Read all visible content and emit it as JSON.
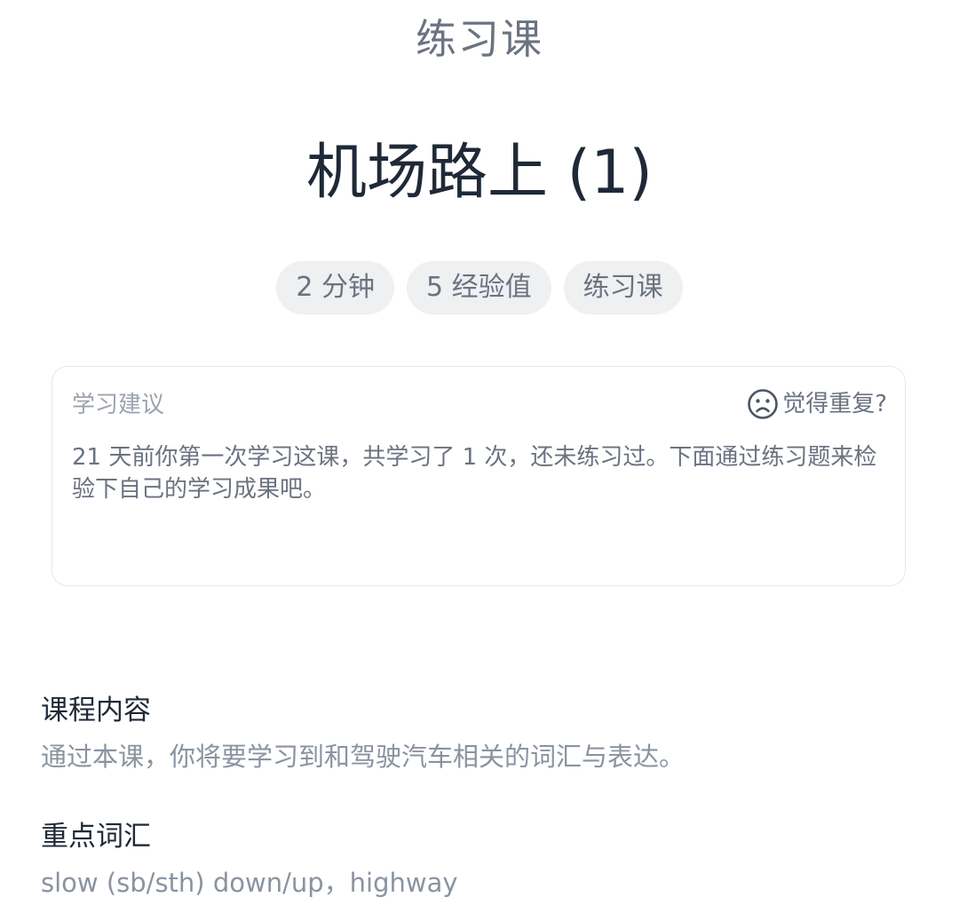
{
  "header": {
    "title": "练习课"
  },
  "lesson": {
    "title": "机场路上 (1)"
  },
  "tags": [
    "2 分钟",
    "5 经验值",
    "练习课"
  ],
  "advice": {
    "label": "学习建议",
    "repeat_label": "觉得重复?",
    "repeat_icon": "sad-face-icon",
    "text": "21 天前你第一次学习这课，共学习了 1 次，还未练习过。下面通过练习题来检验下自己的学习成果吧。"
  },
  "course_content": {
    "title": "课程内容",
    "text": "通过本课，你将要学习到和驾驶汽车相关的词汇与表达。"
  },
  "key_vocab": {
    "title": "重点词汇",
    "text": "slow (sb/sth) down/up，highway"
  }
}
